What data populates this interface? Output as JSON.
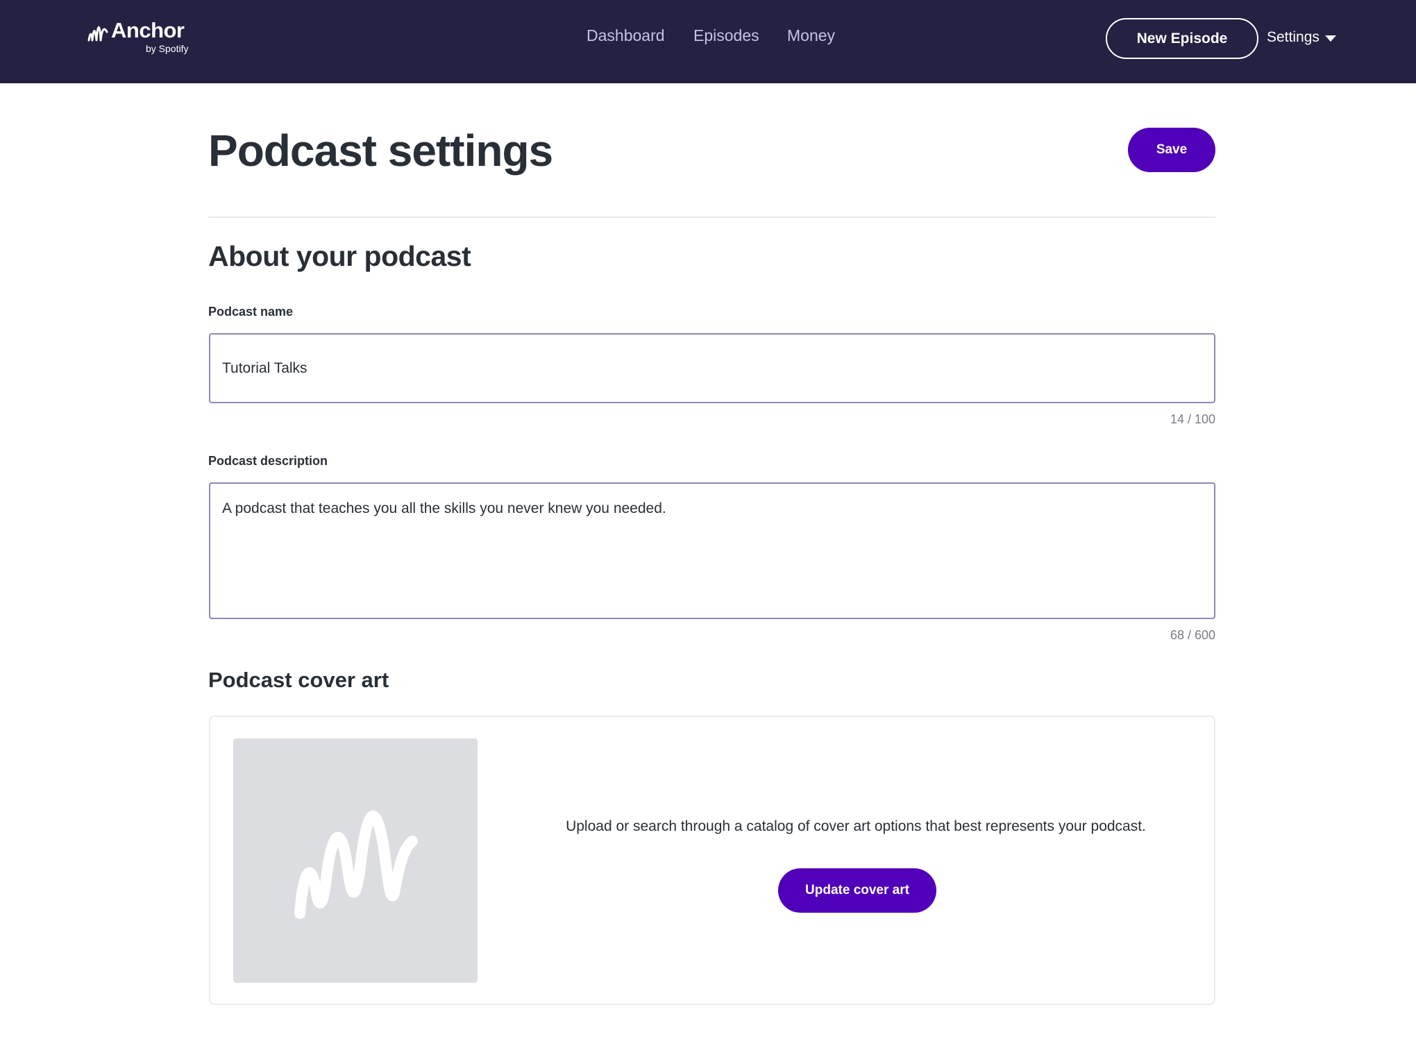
{
  "header": {
    "logo": {
      "name": "Anchor",
      "sub": "by Spotify"
    },
    "nav": [
      "Dashboard",
      "Episodes",
      "Money"
    ],
    "new_episode_label": "New Episode",
    "settings_label": "Settings"
  },
  "page": {
    "title": "Podcast settings",
    "save_label": "Save"
  },
  "about": {
    "title": "About your podcast",
    "name_label": "Podcast name",
    "name_value": "Tutorial Talks",
    "name_counter": "14 / 100",
    "description_label": "Podcast description",
    "description_value": "A podcast that teaches you all the skills you never knew you needed.",
    "description_counter": "68 / 600"
  },
  "cover_art": {
    "title": "Podcast cover art",
    "description": "Upload or search through a catalog of cover art options that best represents your podcast.",
    "update_label": "Update cover art",
    "placeholder_icon": "anchor-wave-icon"
  },
  "colors": {
    "header_bg": "#242143",
    "accent": "#5000b9",
    "placeholder_bg": "#dcdde0"
  }
}
